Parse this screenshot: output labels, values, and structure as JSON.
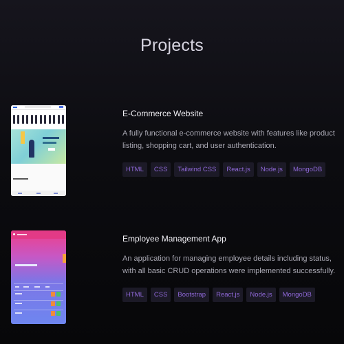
{
  "page": {
    "title": "Projects"
  },
  "projects": [
    {
      "title": "E-Commerce Website",
      "description": "A fully functional e-commerce website with features like product listing, shopping cart, and user authentication.",
      "thumbnail": "e-commerce-site-preview",
      "tags": [
        "HTML",
        "CSS",
        "Tailwind CSS",
        "React.js",
        "Node.js",
        "MongoDB"
      ]
    },
    {
      "title": "Employee Management App",
      "description": "An application for managing employee details including status, with all basic CRUD operations were implemented successfully.",
      "thumbnail": "employee-app-preview",
      "tags": [
        "HTML",
        "CSS",
        "Bootstrap",
        "React.js",
        "Node.js",
        "MongoDB"
      ]
    }
  ],
  "colors": {
    "background_top": "#16151d",
    "background_bottom": "#070709",
    "tag_background": "#1c1a27",
    "tag_text": "#8f68d8"
  }
}
